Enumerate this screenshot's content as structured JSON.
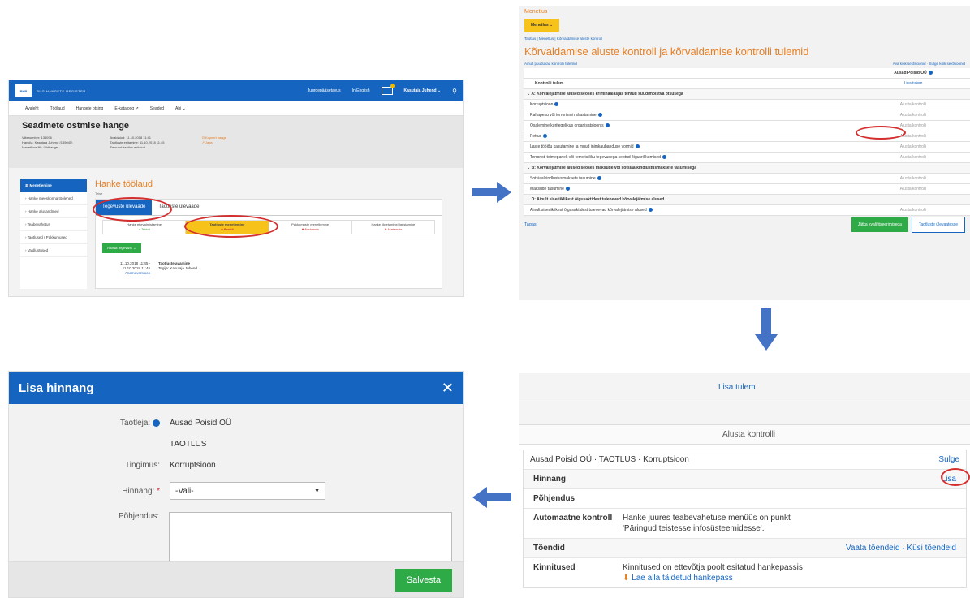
{
  "panel1": {
    "logo_text": "RIIGIHANGETE REGISTER",
    "logo_badge": "RHR",
    "topnav": [
      "Juurdepääsetavus",
      "In English"
    ],
    "user": "Kasutaja Juhend ⌄",
    "menu": [
      "Avaleht",
      "Töölaud",
      "Hangete otsing",
      "E-kataloog ↗",
      "Seaded",
      "Abi ⌄"
    ],
    "title": "Seadmete ostmise hange",
    "meta_col1": [
      "Viitenumber: 135096",
      "Hankija: Kasutaja Juhend (155045)",
      "Menetluse liik: Lihthange"
    ],
    "meta_col2": [
      "Avaldatud: 11.10.2018 11:41",
      "Taotluste esitamine: 11.10.2018 11.45",
      "Seisund: taotlus esitatud"
    ],
    "meta_links": [
      "⊡ Kopeeri hange",
      "↗ Jaga"
    ],
    "sidebar_active": "Menetlemine",
    "sidebar": [
      "Hanke meeskonna töölehed",
      "Hanke alusandmed",
      "Teabevahetus",
      "Taotlused / Pakkumused",
      "Vaidlustused"
    ],
    "main_title": "Hanke töölaud",
    "crumb": "Teise",
    "tabs": [
      "Tegevuste ülevaade",
      "Taotluste ülevaade"
    ],
    "steps": [
      {
        "name": "Hanke ettevalmistamine",
        "status": "✔ Tehtud"
      },
      {
        "name": "Taotluste menetlemine",
        "status": "⊘ Pooleli"
      },
      {
        "name": "Pakkumuste menetlemine",
        "status": "✖ Alustamata"
      },
      {
        "name": "Hanke lõpetamine/Ilgestamine",
        "status": "✖ Alustamata"
      }
    ],
    "start_button": "Alusta tegevust ⌄",
    "timeline_date1": "11.10.2018 11:45 -",
    "timeline_date2": "11.10.2018 11:45",
    "timeline_link": "Andmeversioon",
    "timeline_title": "Taotluste avamine",
    "timeline_sub": "Tegija: Kasutaja Juhend"
  },
  "panel2": {
    "section": "Menetlus",
    "button": "Menetlus ⌄",
    "crumb": "Taotlus | Menetlus | Kõrvaldamise aluste kontroll",
    "title": "Kõrvaldamise aluste kontroll ja kõrvaldamise kontrolli tulemid",
    "left_link": "Ainult puuduvad kontrolli tulemid",
    "right_links": "Ava kõik sektsioonid · Sulge kõik sektsioonid",
    "company": "Ausad Poisid OÜ",
    "col_header": "Kontrolli tulem",
    "add_result": "Lisa tulem",
    "groups": [
      {
        "title": "A: Kõrvalejätmise alused seoses kriminaalasjas tehtud süüdimõistva otsusega",
        "rows": [
          "Korruptsioon",
          "Rahapesu või terrorismi rahastamine",
          "Osalemine kuritegelikus organisatsioonis",
          "Pettus",
          "Laste tööjõu kasutamine ja muud inimkaubanduse vormid",
          "Terroristi toimepanek või terroristliku tegevusega seotud õigusrikkumised"
        ]
      },
      {
        "title": "B: Kõrvalejätmise alused seoses maksude või sotsiaalkindlustusmaksete tasumisega",
        "rows": [
          "Sotsiaalkindlustusmaksete tasumine",
          "Maksude tasumine"
        ]
      },
      {
        "title": "D: Ainult siseriiklikest õigusaktidest tulenevad kõrvalejätmise alused",
        "rows": [
          "Ainult siseriiklikest õigusaktidest tulenevad kõrvalejätmise alused"
        ]
      }
    ],
    "row_action": "Alusta kontrolli",
    "back": "Tagasi",
    "next": "Jätka kvalifitseerimisega",
    "overview": "Taotluste ülevaatesse"
  },
  "panel3": {
    "add_result": "Lisa tulem",
    "start": "Alusta kontrolli",
    "header": "Ausad Poisid OÜ · TAOTLUS · Korruptsioon",
    "close": "Sulge",
    "hinnang": "Hinnang",
    "lisa": "Lisa",
    "pohjendus": "Põhjendus",
    "auto_k": "Automaatne kontroll",
    "auto_v1": "Hanke juures teabevahetuse menüüs on punkt",
    "auto_v2": "'Päringud teistesse infosüsteemidesse'.",
    "toendid": "Tõendid",
    "toendid_links": "Vaata tõendeid · Küsi tõendeid",
    "kinnitused": "Kinnitused",
    "kinn_v": "Kinnitused on ettevõtja poolt esitatud hankepassis",
    "download": "Lae alla täidetud hankepass"
  },
  "panel4": {
    "title": "Lisa hinnang",
    "close": "✕",
    "applicant_label": "Taotleja:",
    "applicant": "Ausad Poisid OÜ",
    "taotlus": "TAOTLUS",
    "cond_label": "Tingimus:",
    "cond": "Korruptsioon",
    "rating_label": "Hinnang:",
    "rating_value": "-Vali-",
    "reason_label": "Põhjendus:",
    "save": "Salvesta"
  },
  "colors": {
    "brand": "#1565c0",
    "accent": "#e67e22",
    "green": "#2eaa47",
    "highlight": "#f7c21a",
    "ring": "#d32f2f"
  }
}
